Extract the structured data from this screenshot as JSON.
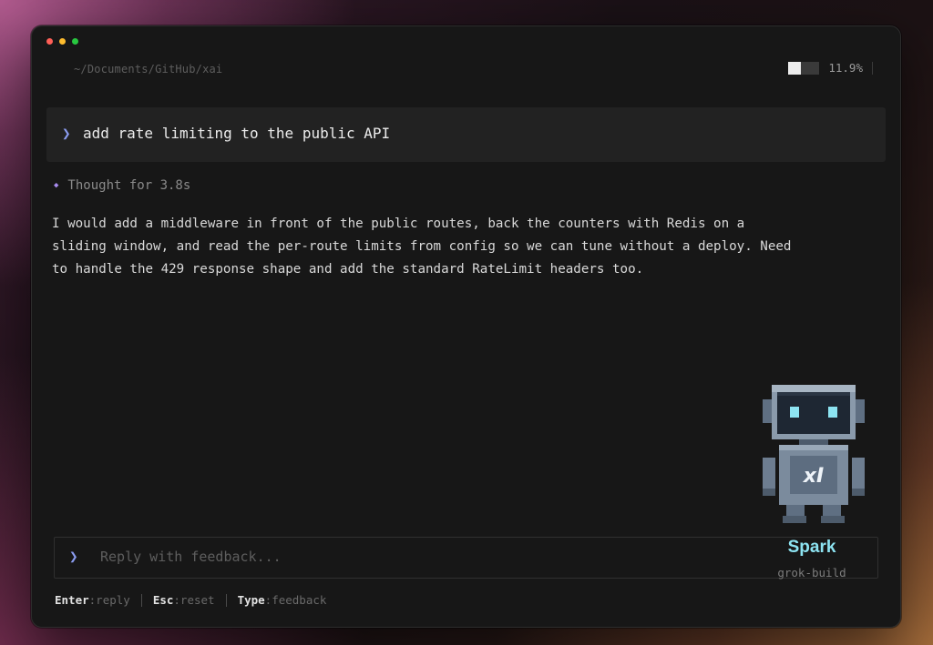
{
  "window": {
    "cwd_path": "~/Documents/GitHub/xai",
    "usage": {
      "percent_text": "11.9%",
      "fill_fraction": 0.4
    }
  },
  "prompt": {
    "chevron": "❯",
    "text": "add rate limiting to the public API"
  },
  "thought": {
    "icon": "sparkle-icon",
    "text": "Thought for 3.8s"
  },
  "response": {
    "lines": [
      "I would add a middleware in front of the public routes, back the counters with Redis on a",
      "sliding window, and read the per-route limits from config so we can tune without a deploy. Need",
      "to handle the 429 response shape and add the standard RateLimit headers too."
    ]
  },
  "reply": {
    "chevron": "❯",
    "placeholder": "Reply with feedback...",
    "value": ""
  },
  "hints": [
    {
      "key": "Enter",
      "action": "reply"
    },
    {
      "key": "Esc",
      "action": "reset"
    },
    {
      "key": "Type",
      "action": "feedback"
    }
  ],
  "mascot": {
    "icon": "robot-mascot-icon",
    "badge": "xI",
    "name": "Spark",
    "subtitle": "grok-build"
  },
  "colors": {
    "accent": "#8b9cf0",
    "mascot_name": "#8de4f2",
    "thought_icon": "#a98cf0",
    "traffic_red": "#ff5f57",
    "traffic_yellow": "#febc2e",
    "traffic_green": "#28c840"
  }
}
